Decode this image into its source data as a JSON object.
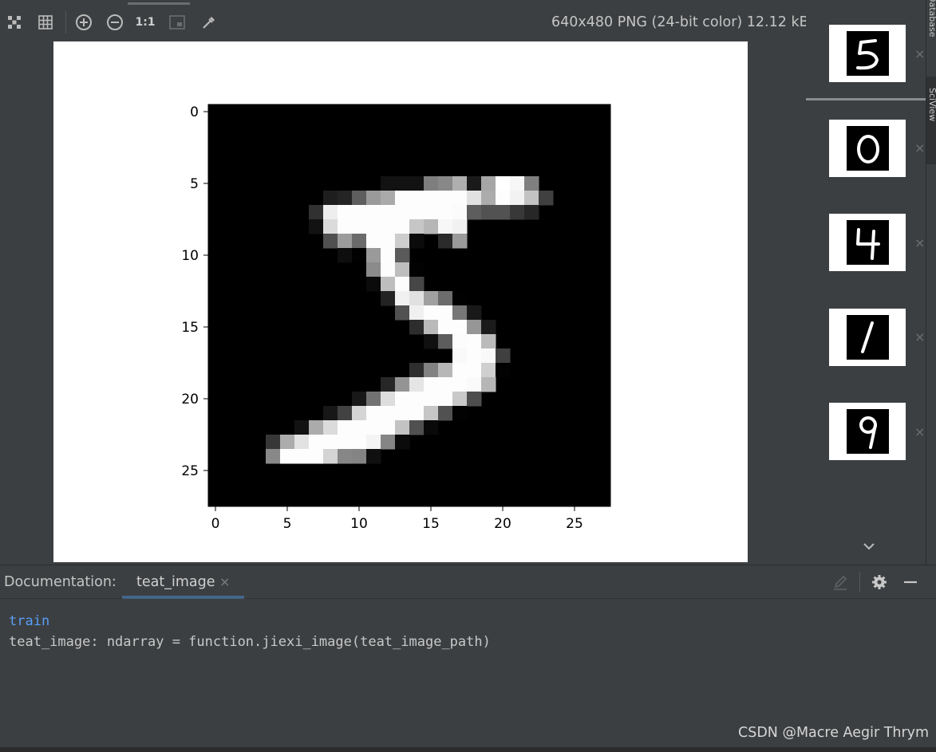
{
  "toolbar": {
    "buttons": [
      {
        "name": "fit-to-window-icon"
      },
      {
        "name": "grid-icon"
      },
      {
        "name": "zoom-in-icon"
      },
      {
        "name": "zoom-out-icon"
      },
      {
        "name": "actual-size-button",
        "label": "1:1"
      },
      {
        "name": "background-icon"
      },
      {
        "name": "color-picker-icon"
      }
    ],
    "file_info": "640x480 PNG (24-bit color) 12.12 kB"
  },
  "thumbnails": [
    {
      "digit": "5",
      "close": "×"
    },
    {
      "digit": "0",
      "close": "×"
    },
    {
      "digit": "4",
      "close": "×"
    },
    {
      "digit": "1",
      "close": "×"
    },
    {
      "digit": "9",
      "close": "×"
    }
  ],
  "side_tabs": [
    "Database",
    "SciView"
  ],
  "chart_data": {
    "type": "heatmap",
    "colormap": "gray",
    "rows": 28,
    "cols": 28,
    "xticks": [
      "0",
      "5",
      "10",
      "15",
      "20",
      "25"
    ],
    "yticks": [
      "0",
      "5",
      "10",
      "15",
      "20",
      "25"
    ],
    "xlim": [
      -0.5,
      27.5
    ],
    "ylim": [
      27.5,
      -0.5
    ],
    "content": "MNIST digit 5",
    "pixels": [
      [
        5,
        12,
        18,
        0.07
      ],
      [
        5,
        13,
        18,
        0.07
      ],
      [
        5,
        14,
        18,
        0.07
      ],
      [
        5,
        15,
        126,
        0.49
      ],
      [
        5,
        16,
        136,
        0.53
      ],
      [
        5,
        17,
        175,
        0.69
      ],
      [
        5,
        18,
        26,
        0.1
      ],
      [
        5,
        19,
        166,
        0.65
      ],
      [
        5,
        20,
        255,
        1
      ],
      [
        5,
        21,
        247,
        0.97
      ],
      [
        5,
        22,
        127,
        0.5
      ],
      [
        6,
        8,
        30,
        0.12
      ],
      [
        6,
        9,
        36,
        0.14
      ],
      [
        6,
        10,
        94,
        0.37
      ],
      [
        6,
        11,
        154,
        0.6
      ],
      [
        6,
        12,
        170,
        0.67
      ],
      [
        6,
        13,
        253,
        0.99
      ],
      [
        6,
        14,
        253,
        0.99
      ],
      [
        6,
        15,
        253,
        0.99
      ],
      [
        6,
        16,
        253,
        0.99
      ],
      [
        6,
        17,
        253,
        0.99
      ],
      [
        6,
        18,
        225,
        0.88
      ],
      [
        6,
        19,
        172,
        0.67
      ],
      [
        6,
        20,
        253,
        0.99
      ],
      [
        6,
        21,
        242,
        0.95
      ],
      [
        6,
        22,
        195,
        0.76
      ],
      [
        6,
        23,
        64,
        0.25
      ],
      [
        7,
        7,
        49,
        0.19
      ],
      [
        7,
        8,
        238,
        0.93
      ],
      [
        7,
        9,
        253,
        0.99
      ],
      [
        7,
        10,
        253,
        0.99
      ],
      [
        7,
        11,
        253,
        0.99
      ],
      [
        7,
        12,
        253,
        0.99
      ],
      [
        7,
        13,
        253,
        0.99
      ],
      [
        7,
        14,
        253,
        0.99
      ],
      [
        7,
        15,
        253,
        0.99
      ],
      [
        7,
        16,
        253,
        0.99
      ],
      [
        7,
        17,
        251,
        0.98
      ],
      [
        7,
        18,
        93,
        0.36
      ],
      [
        7,
        19,
        82,
        0.32
      ],
      [
        7,
        20,
        82,
        0.32
      ],
      [
        7,
        21,
        56,
        0.22
      ],
      [
        7,
        22,
        39,
        0.15
      ],
      [
        8,
        7,
        18,
        0.07
      ],
      [
        8,
        8,
        219,
        0.86
      ],
      [
        8,
        9,
        253,
        0.99
      ],
      [
        8,
        10,
        253,
        0.99
      ],
      [
        8,
        11,
        253,
        0.99
      ],
      [
        8,
        12,
        253,
        0.99
      ],
      [
        8,
        13,
        253,
        0.99
      ],
      [
        8,
        14,
        198,
        0.78
      ],
      [
        8,
        15,
        182,
        0.71
      ],
      [
        8,
        16,
        247,
        0.97
      ],
      [
        8,
        17,
        241,
        0.95
      ],
      [
        9,
        8,
        80,
        0.31
      ],
      [
        9,
        9,
        156,
        0.61
      ],
      [
        9,
        10,
        107,
        0.42
      ],
      [
        9,
        11,
        253,
        0.99
      ],
      [
        9,
        12,
        253,
        0.99
      ],
      [
        9,
        13,
        205,
        0.8
      ],
      [
        9,
        14,
        11,
        0.04
      ],
      [
        9,
        16,
        43,
        0.17
      ],
      [
        9,
        17,
        154,
        0.6
      ],
      [
        10,
        9,
        14,
        0.05
      ],
      [
        10,
        10,
        1,
        0.004
      ],
      [
        10,
        11,
        154,
        0.6
      ],
      [
        10,
        12,
        253,
        0.99
      ],
      [
        10,
        13,
        90,
        0.35
      ],
      [
        11,
        11,
        139,
        0.55
      ],
      [
        11,
        12,
        253,
        0.99
      ],
      [
        11,
        13,
        190,
        0.75
      ],
      [
        11,
        14,
        2,
        0.01
      ],
      [
        12,
        11,
        11,
        0.04
      ],
      [
        12,
        12,
        190,
        0.75
      ],
      [
        12,
        13,
        253,
        0.99
      ],
      [
        12,
        14,
        70,
        0.27
      ],
      [
        13,
        12,
        35,
        0.14
      ],
      [
        13,
        13,
        241,
        0.95
      ],
      [
        13,
        14,
        225,
        0.88
      ],
      [
        13,
        15,
        160,
        0.63
      ],
      [
        13,
        16,
        108,
        0.42
      ],
      [
        13,
        17,
        1,
        0.004
      ],
      [
        14,
        13,
        81,
        0.32
      ],
      [
        14,
        14,
        240,
        0.94
      ],
      [
        14,
        15,
        253,
        0.99
      ],
      [
        14,
        16,
        253,
        0.99
      ],
      [
        14,
        17,
        119,
        0.47
      ],
      [
        14,
        18,
        25,
        0.1
      ],
      [
        15,
        14,
        45,
        0.18
      ],
      [
        15,
        15,
        186,
        0.73
      ],
      [
        15,
        16,
        253,
        0.99
      ],
      [
        15,
        17,
        253,
        0.99
      ],
      [
        15,
        18,
        150,
        0.59
      ],
      [
        15,
        19,
        27,
        0.11
      ],
      [
        16,
        15,
        16,
        0.06
      ],
      [
        16,
        16,
        93,
        0.36
      ],
      [
        16,
        17,
        252,
        0.99
      ],
      [
        16,
        18,
        253,
        0.99
      ],
      [
        16,
        19,
        187,
        0.73
      ],
      [
        17,
        17,
        249,
        0.98
      ],
      [
        17,
        18,
        253,
        0.99
      ],
      [
        17,
        19,
        249,
        0.98
      ],
      [
        17,
        20,
        64,
        0.25
      ],
      [
        18,
        14,
        46,
        0.18
      ],
      [
        18,
        15,
        130,
        0.51
      ],
      [
        18,
        16,
        183,
        0.72
      ],
      [
        18,
        17,
        253,
        0.99
      ],
      [
        18,
        18,
        253,
        0.99
      ],
      [
        18,
        19,
        207,
        0.81
      ],
      [
        18,
        20,
        2,
        0.01
      ],
      [
        19,
        12,
        39,
        0.15
      ],
      [
        19,
        13,
        148,
        0.58
      ],
      [
        19,
        14,
        229,
        0.9
      ],
      [
        19,
        15,
        253,
        0.99
      ],
      [
        19,
        16,
        253,
        0.99
      ],
      [
        19,
        17,
        253,
        0.99
      ],
      [
        19,
        18,
        250,
        0.98
      ],
      [
        19,
        19,
        182,
        0.71
      ],
      [
        20,
        10,
        24,
        0.09
      ],
      [
        20,
        11,
        114,
        0.45
      ],
      [
        20,
        12,
        221,
        0.87
      ],
      [
        20,
        13,
        253,
        0.99
      ],
      [
        20,
        14,
        253,
        0.99
      ],
      [
        20,
        15,
        253,
        0.99
      ],
      [
        20,
        16,
        253,
        0.99
      ],
      [
        20,
        17,
        201,
        0.79
      ],
      [
        20,
        18,
        78,
        0.31
      ],
      [
        21,
        8,
        23,
        0.09
      ],
      [
        21,
        9,
        66,
        0.26
      ],
      [
        21,
        10,
        213,
        0.84
      ],
      [
        21,
        11,
        253,
        0.99
      ],
      [
        21,
        12,
        253,
        0.99
      ],
      [
        21,
        13,
        253,
        0.99
      ],
      [
        21,
        14,
        253,
        0.99
      ],
      [
        21,
        15,
        198,
        0.78
      ],
      [
        21,
        16,
        81,
        0.32
      ],
      [
        21,
        17,
        2,
        0.01
      ],
      [
        22,
        6,
        18,
        0.07
      ],
      [
        22,
        7,
        171,
        0.67
      ],
      [
        22,
        8,
        219,
        0.86
      ],
      [
        22,
        9,
        253,
        0.99
      ],
      [
        22,
        10,
        253,
        0.99
      ],
      [
        22,
        11,
        253,
        0.99
      ],
      [
        22,
        12,
        253,
        0.99
      ],
      [
        22,
        13,
        195,
        0.76
      ],
      [
        22,
        14,
        80,
        0.31
      ],
      [
        22,
        15,
        9,
        0.04
      ],
      [
        23,
        4,
        55,
        0.22
      ],
      [
        23,
        5,
        172,
        0.67
      ],
      [
        23,
        6,
        226,
        0.89
      ],
      [
        23,
        7,
        253,
        0.99
      ],
      [
        23,
        8,
        253,
        0.99
      ],
      [
        23,
        9,
        253,
        0.99
      ],
      [
        23,
        10,
        253,
        0.99
      ],
      [
        23,
        11,
        244,
        0.96
      ],
      [
        23,
        12,
        133,
        0.52
      ],
      [
        23,
        13,
        11,
        0.04
      ],
      [
        24,
        4,
        136,
        0.53
      ],
      [
        24,
        5,
        253,
        0.99
      ],
      [
        24,
        6,
        253,
        0.99
      ],
      [
        24,
        7,
        253,
        0.99
      ],
      [
        24,
        8,
        212,
        0.83
      ],
      [
        24,
        9,
        135,
        0.53
      ],
      [
        24,
        10,
        132,
        0.52
      ],
      [
        24,
        11,
        16,
        0.06
      ]
    ]
  },
  "doc_panel": {
    "title": "Documentation:",
    "tab_label": "teat_image",
    "tab_close": "×",
    "module": "train",
    "signature": "teat_image: ndarray = function.jiexi_image(teat_image_path)"
  },
  "watermark": "CSDN @Macre Aegir Thrym"
}
